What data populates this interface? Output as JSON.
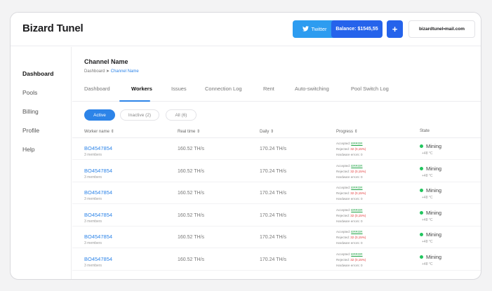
{
  "header": {
    "brand": "Bizard Tunel",
    "twitter_label": "Twitter",
    "balance_label": "Balance: $1545,55",
    "plus_label": "+",
    "email": "bizardtunel•mail.com"
  },
  "sidebar": {
    "items": [
      {
        "label": "Dashboard"
      },
      {
        "label": "Pools"
      },
      {
        "label": "Billing"
      },
      {
        "label": "Profile"
      },
      {
        "label": "Help"
      }
    ]
  },
  "main": {
    "channel_title": "Channel Name",
    "breadcrumb": {
      "root": "Dashboard",
      "separator": "➤",
      "current": "Channel Name"
    },
    "tabs": [
      {
        "label": "Dashboard"
      },
      {
        "label": "Workers"
      },
      {
        "label": "Issues"
      },
      {
        "label": "Connection Log"
      },
      {
        "label": "Rent"
      },
      {
        "label": "Auto-switching"
      },
      {
        "label": "Pool Switch Log"
      }
    ],
    "filters": {
      "active": "Active",
      "inactive": "Inactive (2)",
      "all": "All (6)"
    },
    "columns": {
      "worker": "Worker name ⇕",
      "realtime": "Real time ⇕",
      "daily": "Daily ⇕",
      "progress": "Progress ⇕",
      "state": "State"
    },
    "rows": [
      {
        "name": "BO4547854",
        "members": "3 members",
        "realtime": "160.52 TH/s",
        "daily": "170.24 TH/s",
        "acc_label": "Accepted:",
        "acc_val": "ERROR",
        "rej_label": "Rejected:",
        "rej_val": "32 (0,15%)",
        "hw": "Hardware errors: 0",
        "state": "Mining",
        "temp": "+48 °C"
      },
      {
        "name": "BO4547854",
        "members": "3 members",
        "realtime": "160.52 TH/s",
        "daily": "170.24 TH/s",
        "acc_label": "Accepted:",
        "acc_val": "ERROR",
        "rej_label": "Rejected:",
        "rej_val": "32 (0,15%)",
        "hw": "Hardware errors: 0",
        "state": "Mining",
        "temp": "+48 °C"
      },
      {
        "name": "BO4547854",
        "members": "3 members",
        "realtime": "160.52 TH/s",
        "daily": "170.24 TH/s",
        "acc_label": "Accepted:",
        "acc_val": "ERROR",
        "rej_label": "Rejected:",
        "rej_val": "32 (0,15%)",
        "hw": "Hardware errors: 0",
        "state": "Mining",
        "temp": "+48 °C"
      },
      {
        "name": "BO4547854",
        "members": "3 members",
        "realtime": "160.52 TH/s",
        "daily": "170.24 TH/s",
        "acc_label": "Accepted:",
        "acc_val": "ERROR",
        "rej_label": "Rejected:",
        "rej_val": "32 (0,15%)",
        "hw": "Hardware errors: 0",
        "state": "Mining",
        "temp": "+48 °C"
      },
      {
        "name": "BO4547854",
        "members": "3 members",
        "realtime": "160.52 TH/s",
        "daily": "170.24 TH/s",
        "acc_label": "Accepted:",
        "acc_val": "ERROR",
        "rej_label": "Rejected:",
        "rej_val": "32 (0,15%)",
        "hw": "Hardware errors: 0",
        "state": "Mining",
        "temp": "+48 °C"
      },
      {
        "name": "BO4547854",
        "members": "3 members",
        "realtime": "160.52 TH/s",
        "daily": "170.24 TH/s",
        "acc_label": "Accepted:",
        "acc_val": "ERROR",
        "rej_label": "Rejected:",
        "rej_val": "32 (0,15%)",
        "hw": "Hardware errors: 0",
        "state": "Mining",
        "temp": "+48 °C"
      }
    ]
  },
  "colors": {
    "accent": "#2d84e8",
    "twitter": "#2d9cf0",
    "primary": "#2563eb",
    "success": "#22c55e",
    "danger": "#e23a3a"
  }
}
